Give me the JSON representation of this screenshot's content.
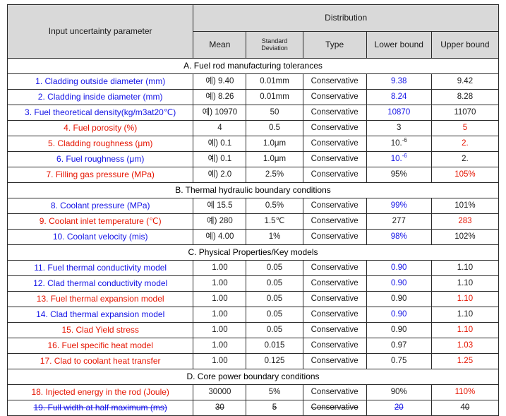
{
  "table": {
    "header": {
      "param_label": "Input uncertainty parameter",
      "distribution_label": "Distribution",
      "mean_label": "Mean",
      "std_label_line1": "Standard",
      "std_label_line2": "Deviation",
      "type_label": "Type",
      "lower_label": "Lower bound",
      "upper_label": "Upper bound"
    },
    "colors": {
      "blue": "#1414e6",
      "red": "#e51400",
      "black": "#1a1a1a",
      "header_bg": "#d9d9d9",
      "border": "#2b2b2b"
    },
    "sections": [
      {
        "title": "A. Fuel rod manufacturing tolerances",
        "rows": [
          {
            "name": "1. Cladding outside diameter (mm)",
            "name_color": "blue",
            "mean": "예) 9.40",
            "mean_color": "black",
            "std": "0.01mm",
            "std_color": "black",
            "type": "Conservative",
            "type_color": "black",
            "lower": "9.38",
            "lower_color": "blue",
            "upper": "9.42",
            "upper_color": "black"
          },
          {
            "name": "2. Cladding inside diameter (mm)",
            "name_color": "blue",
            "mean": "예) 8.26",
            "mean_color": "black",
            "std": "0.01mm",
            "std_color": "black",
            "type": "Conservative",
            "type_color": "black",
            "lower": "8.24",
            "lower_color": "blue",
            "upper": "8.28",
            "upper_color": "black"
          },
          {
            "name": "3. Fuel theoretical density(kg/m3at20℃)",
            "name_color": "blue",
            "mean": "예) 10970",
            "mean_color": "black",
            "std": "50",
            "std_color": "black",
            "type": "Conservative",
            "type_color": "black",
            "lower": "10870",
            "lower_color": "blue",
            "upper": "11070",
            "upper_color": "black"
          },
          {
            "name": "4. Fuel porosity (%)",
            "name_color": "red",
            "mean": "4",
            "mean_color": "black",
            "std": "0.5",
            "std_color": "black",
            "type": "Conservative",
            "type_color": "black",
            "lower": "3",
            "lower_color": "black",
            "upper": "5",
            "upper_color": "red"
          },
          {
            "name": "5. Cladding roughness (μm)",
            "name_color": "red",
            "mean": "예) 0.1",
            "mean_color": "black",
            "std": "1.0μm",
            "std_color": "black",
            "type": "Conservative",
            "type_color": "black",
            "lower": "10.-6",
            "lower_color": "black",
            "lower_sup": true,
            "upper": "2.",
            "upper_color": "red"
          },
          {
            "name": "6. Fuel roughness (μm)",
            "name_color": "blue",
            "mean": "예) 0.1",
            "mean_color": "black",
            "std": "1.0μm",
            "std_color": "black",
            "type": "Conservative",
            "type_color": "black",
            "lower": "10.-6",
            "lower_color": "blue",
            "lower_sup": true,
            "upper": "2.",
            "upper_color": "black"
          },
          {
            "name": "7. Filling gas pressure (MPa)",
            "name_color": "red",
            "mean": "예) 2.0",
            "mean_color": "black",
            "std": "2.5%",
            "std_color": "black",
            "type": "Conservative",
            "type_color": "black",
            "lower": "95%",
            "lower_color": "black",
            "upper": "105%",
            "upper_color": "red"
          }
        ]
      },
      {
        "title": "B. Thermal hydraulic boundary conditions",
        "rows": [
          {
            "name": "8. Coolant pressure (MPa)",
            "name_color": "blue",
            "mean": "예 15.5",
            "mean_color": "black",
            "std": "0.5%",
            "std_color": "black",
            "type": "Conservative",
            "type_color": "black",
            "lower": "99%",
            "lower_color": "blue",
            "upper": "101%",
            "upper_color": "black"
          },
          {
            "name": "9. Coolant inlet temperature (℃)",
            "name_color": "red",
            "mean": "예) 280",
            "mean_color": "black",
            "std": "1.5℃",
            "std_color": "black",
            "type": "Conservative",
            "type_color": "black",
            "lower": "277",
            "lower_color": "black",
            "upper": "283",
            "upper_color": "red"
          },
          {
            "name": "10. Coolant velocity (mis)",
            "name_color": "blue",
            "mean": "예) 4.00",
            "mean_color": "black",
            "std": "1%",
            "std_color": "black",
            "type": "Conservative",
            "type_color": "black",
            "lower": "98%",
            "lower_color": "blue",
            "upper": "102%",
            "upper_color": "black"
          }
        ]
      },
      {
        "title": "C. Physical Properties/Key models",
        "rows": [
          {
            "name": "11. Fuel thermal conductivity model",
            "name_color": "blue",
            "mean": "1.00",
            "mean_color": "black",
            "std": "0.05",
            "std_color": "black",
            "type": "Conservative",
            "type_color": "black",
            "lower": "0.90",
            "lower_color": "blue",
            "upper": "1.10",
            "upper_color": "black"
          },
          {
            "name": "12. Clad thermal conductivity model",
            "name_color": "blue",
            "mean": "1.00",
            "mean_color": "black",
            "std": "0.05",
            "std_color": "black",
            "type": "Conservative",
            "type_color": "black",
            "lower": "0.90",
            "lower_color": "blue",
            "upper": "1.10",
            "upper_color": "black"
          },
          {
            "name": "13. Fuel thermal expansion model",
            "name_color": "red",
            "mean": "1.00",
            "mean_color": "black",
            "std": "0.05",
            "std_color": "black",
            "type": "Conservative",
            "type_color": "black",
            "lower": "0.90",
            "lower_color": "black",
            "upper": "1.10",
            "upper_color": "red"
          },
          {
            "name": "14. Clad thermal expansion model",
            "name_color": "blue",
            "mean": "1.00",
            "mean_color": "black",
            "std": "0.05",
            "std_color": "black",
            "type": "Conservative",
            "type_color": "black",
            "lower": "0.90",
            "lower_color": "blue",
            "upper": "1.10",
            "upper_color": "black"
          },
          {
            "name": "15. Clad Yield stress",
            "name_color": "red",
            "mean": "1.00",
            "mean_color": "black",
            "std": "0.05",
            "std_color": "black",
            "type": "Conservative",
            "type_color": "black",
            "lower": "0.90",
            "lower_color": "black",
            "upper": "1.10",
            "upper_color": "red"
          },
          {
            "name": "16. Fuel specific heat model",
            "name_color": "red",
            "mean": "1.00",
            "mean_color": "black",
            "std": "0.015",
            "std_color": "black",
            "type": "Conservative",
            "type_color": "black",
            "lower": "0.97",
            "lower_color": "black",
            "upper": "1.03",
            "upper_color": "red"
          },
          {
            "name": "17. Clad to coolant heat transfer",
            "name_color": "red",
            "mean": "1.00",
            "mean_color": "black",
            "std": "0.125",
            "std_color": "black",
            "type": "Conservative",
            "type_color": "black",
            "lower": "0.75",
            "lower_color": "black",
            "upper": "1.25",
            "upper_color": "red"
          }
        ]
      },
      {
        "title": "D. Core power boundary conditions",
        "rows": [
          {
            "name": "18. Injected energy in the rod (Joule)",
            "name_color": "red",
            "mean": "30000",
            "mean_color": "black",
            "std": "5%",
            "std_color": "black",
            "type": "Conservative",
            "type_color": "black",
            "lower": "90%",
            "lower_color": "black",
            "upper": "110%",
            "upper_color": "red"
          },
          {
            "name": "19. Full width at half maximum (ms)",
            "name_color": "blue",
            "struck": true,
            "mean": "30",
            "mean_color": "black",
            "std": "5",
            "std_color": "black",
            "type": "Conservative",
            "type_color": "black",
            "lower": "20",
            "lower_color": "blue",
            "upper": "40",
            "upper_color": "black"
          }
        ]
      }
    ]
  }
}
